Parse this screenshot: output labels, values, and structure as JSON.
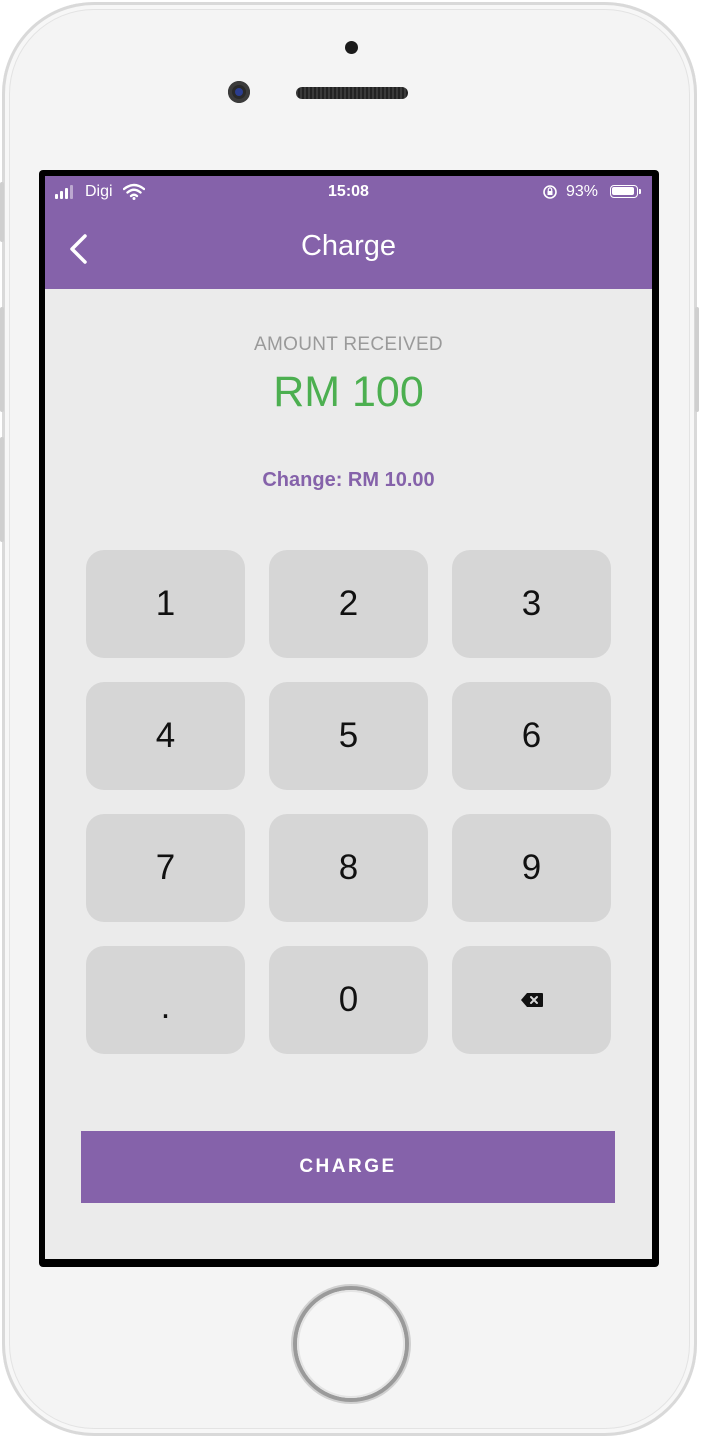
{
  "status_bar": {
    "carrier": "Digi",
    "time": "15:08",
    "battery_percent": "93%",
    "icons": [
      "signal-icon",
      "wifi-icon",
      "rotation-lock-icon",
      "battery-icon"
    ]
  },
  "header": {
    "title": "Charge",
    "back_icon": "chevron-left-icon"
  },
  "amount": {
    "label": "AMOUNT RECEIVED",
    "value": "RM 100"
  },
  "change": {
    "text": "Change: RM 10.00"
  },
  "keypad": {
    "keys": [
      "1",
      "2",
      "3",
      "4",
      "5",
      "6",
      "7",
      "8",
      "9",
      ".",
      "0"
    ],
    "backspace_icon": "backspace-icon"
  },
  "actions": {
    "charge_label": "CHARGE"
  },
  "colors": {
    "brand": "#8562aa",
    "amount": "#4caf50",
    "key_background": "#d6d6d6",
    "screen_background": "#ebebeb"
  }
}
